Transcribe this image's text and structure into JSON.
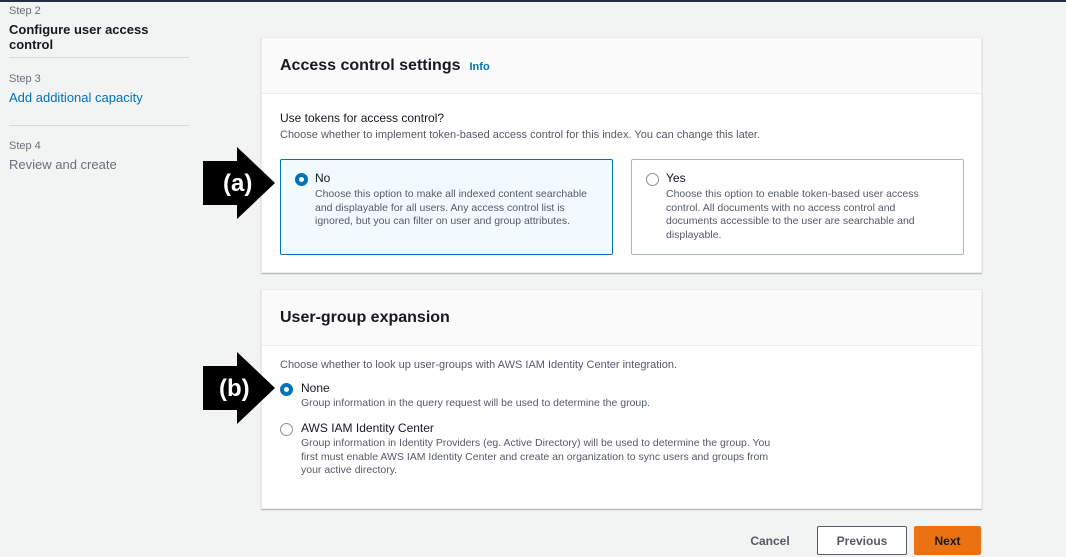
{
  "sidebar": {
    "steps": [
      {
        "num": "Step 2",
        "title": "Configure user access control",
        "state": "current"
      },
      {
        "num": "Step 3",
        "title": "Add additional capacity",
        "state": "link"
      },
      {
        "num": "Step 4",
        "title": "Review and create",
        "state": "disabled"
      }
    ]
  },
  "access_panel": {
    "title": "Access control settings",
    "info": "Info",
    "label": "Use tokens for access control?",
    "description": "Choose whether to implement token-based access control for this index. You can change this later.",
    "options": [
      {
        "title": "No",
        "selected": true,
        "description": "Choose this option to make all indexed content searchable and displayable for all users. Any access control list is ignored, but you can filter on user and group attributes."
      },
      {
        "title": "Yes",
        "selected": false,
        "description": "Choose this option to enable token-based user access control. All documents with no access control and documents accessible to the user are searchable and displayable."
      }
    ]
  },
  "group_panel": {
    "title": "User-group expansion",
    "description": "Choose whether to look up user-groups with AWS IAM Identity Center integration.",
    "options": [
      {
        "title": "None",
        "selected": true,
        "description": "Group information in the query request will be used to determine the group."
      },
      {
        "title": "AWS IAM Identity Center",
        "selected": false,
        "description": "Group information in Identity Providers (eg. Active Directory) will be used to determine the group. You first must enable AWS IAM Identity Center and create an organization to sync users and groups from your active directory."
      }
    ]
  },
  "annotations": {
    "a": "(a)",
    "b": "(b)"
  },
  "footer": {
    "cancel": "Cancel",
    "previous": "Previous",
    "next": "Next"
  },
  "colors": {
    "accent": "#0073bb",
    "primary_button": "#ec7211"
  }
}
